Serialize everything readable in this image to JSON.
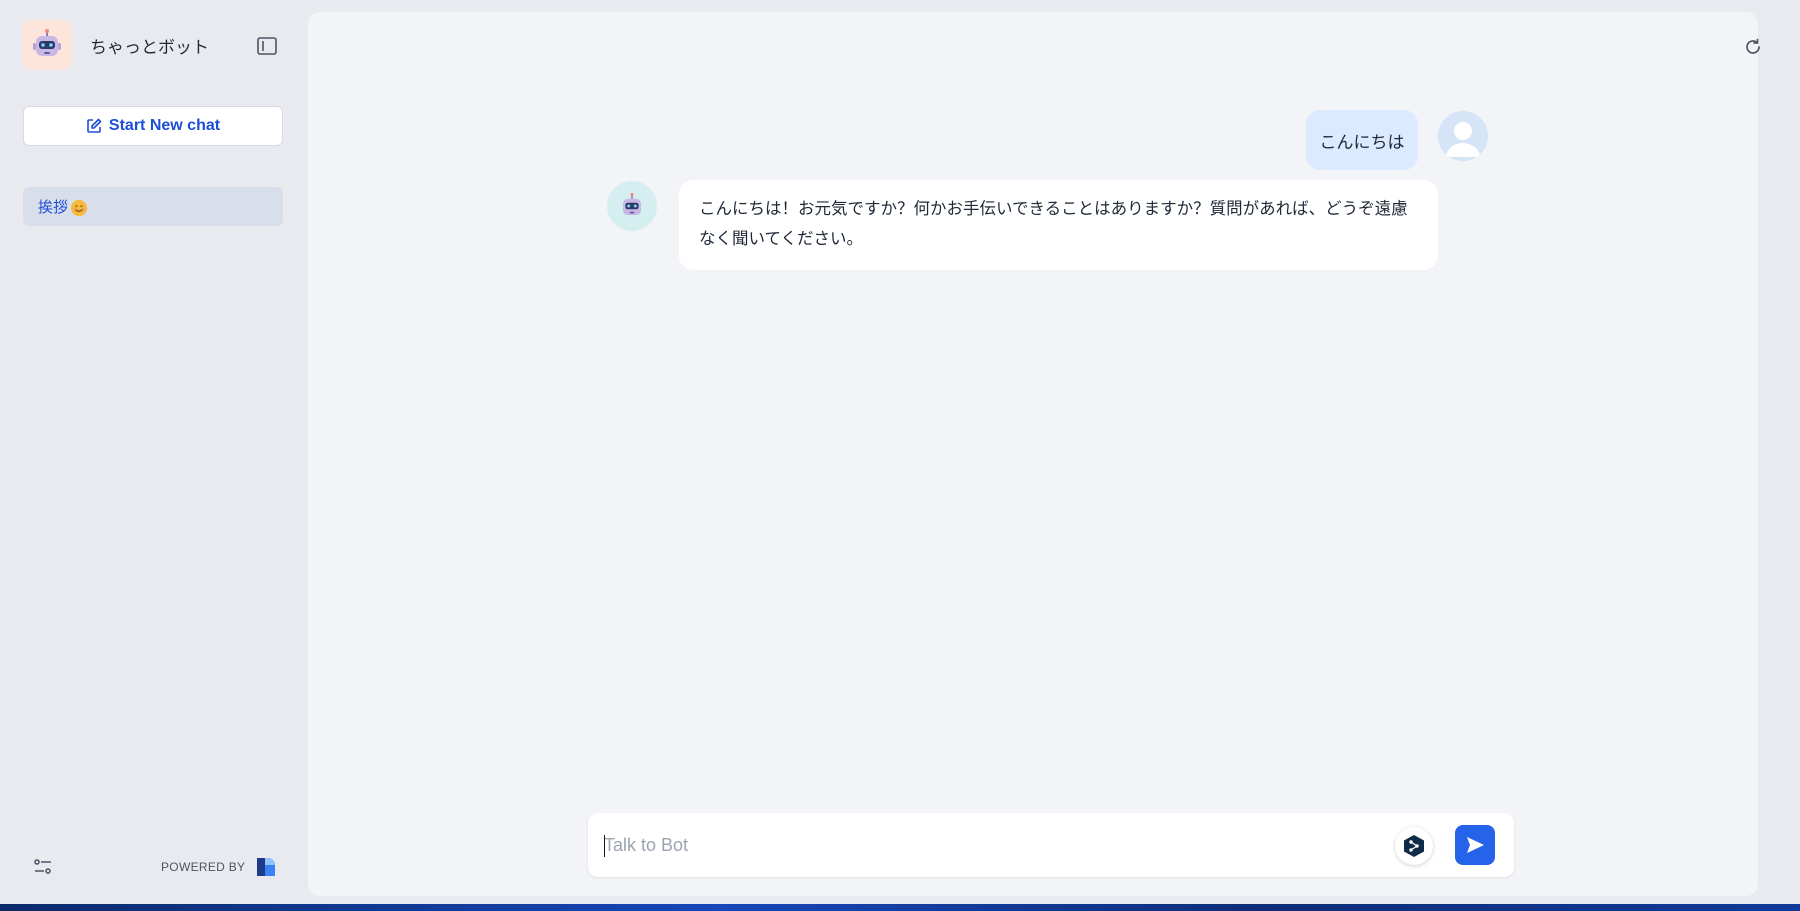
{
  "app": {
    "name": "ちゃっとボット"
  },
  "sidebar": {
    "new_chat_label": "Start New chat",
    "history": [
      {
        "label": "挨拶"
      }
    ],
    "powered_by": "POWERED BY"
  },
  "messages": [
    {
      "role": "user",
      "text": "こんにちは"
    },
    {
      "role": "bot",
      "text": "こんにちは！お元気ですか？何かお手伝いできることはありますか？質問があれば、どうぞ遠慮なく聞いてください。"
    }
  ],
  "composer": {
    "placeholder": "Talk to Bot",
    "value": ""
  },
  "colors": {
    "accent": "#2563eb",
    "user_bubble": "#dbeafe",
    "sidebar_bg": "#e8eaef",
    "panel_bg": "#f3f4f7"
  },
  "icons": {
    "brand": "robot-icon",
    "sidebar_toggle": "sidebar-toggle-icon",
    "new_chat": "edit-icon",
    "settings": "sliders-icon",
    "refresh": "refresh-icon",
    "translate": "deepl-icon",
    "send": "send-icon"
  }
}
